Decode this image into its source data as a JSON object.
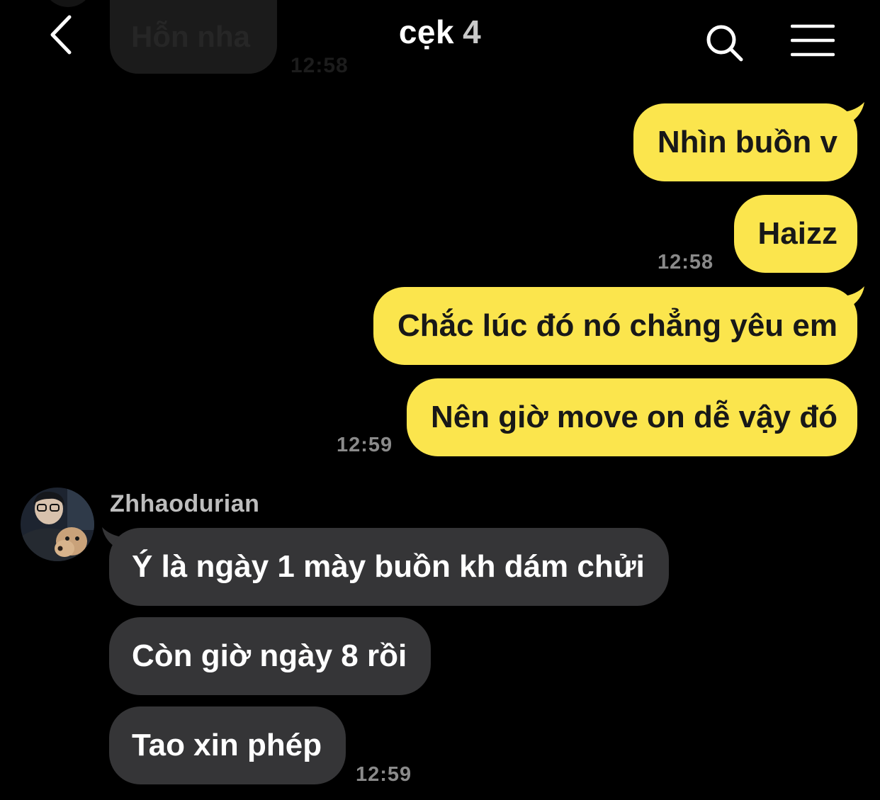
{
  "header": {
    "title": "cẹk",
    "member_count": "4",
    "back_icon": "chevron-left-icon",
    "search_icon": "search-icon",
    "menu_icon": "menu-icon"
  },
  "faded_message": {
    "text": "Hỗn nha",
    "time": "12:58"
  },
  "outgoing": {
    "bubble_color": "#fbe54d",
    "messages": [
      "Nhìn buồn v",
      "Haizz",
      "Chắc lúc đó nó chẳng yêu em",
      "Nên giờ move on dễ vậy đó"
    ],
    "times": [
      "12:58",
      "12:59"
    ]
  },
  "incoming": {
    "sender": "Zhhaodurian",
    "bubble_color": "#353537",
    "messages": [
      "Ý là ngày 1 mày buồn kh dám chửi",
      "Còn giờ ngày 8 rồi",
      "Tao xin phép"
    ],
    "time": "12:59"
  }
}
